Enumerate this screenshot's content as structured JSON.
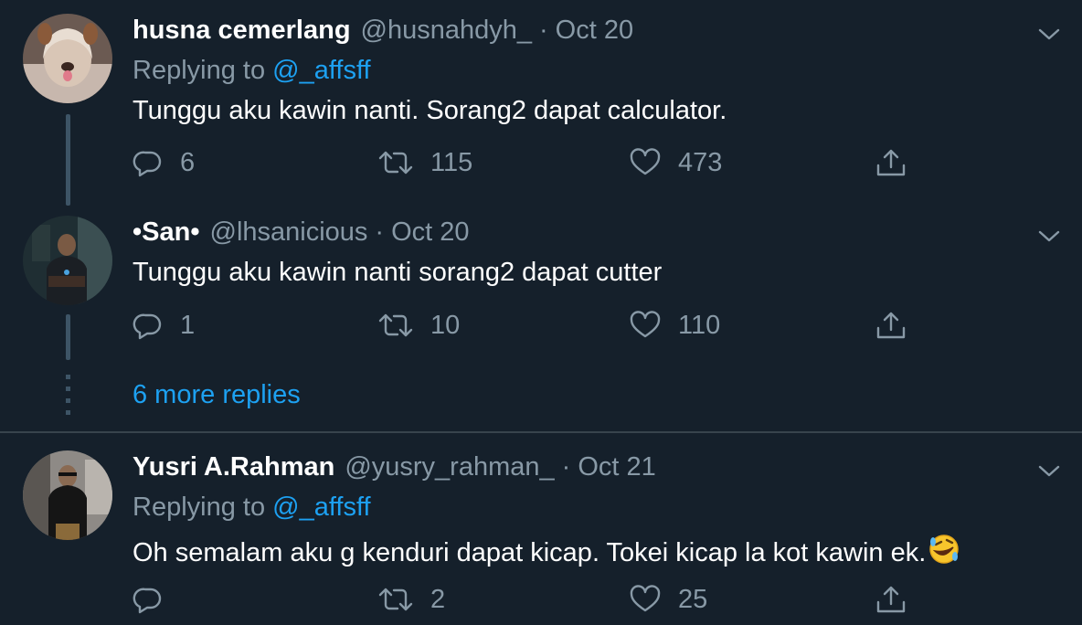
{
  "tweets": [
    {
      "name": "husna cemerlang",
      "handle": "@husnahdyh_",
      "separator": "·",
      "date": "Oct 20",
      "replying_prefix": "Replying to",
      "replying_to": "@_affsff",
      "text": "Tunggu aku kawin nanti. Sorang2 dapat calculator.",
      "replies": "6",
      "retweets": "115",
      "likes": "473"
    },
    {
      "name": "•San•",
      "handle": "@lhsanicious",
      "separator": "·",
      "date": "Oct 20",
      "text": "Tunggu aku kawin nanti sorang2 dapat cutter",
      "replies": "1",
      "retweets": "10",
      "likes": "110"
    },
    {
      "name": "Yusri A.Rahman",
      "handle": "@yusry_rahman_",
      "separator": "·",
      "date": "Oct 21",
      "replying_prefix": "Replying to",
      "replying_to": "@_affsff",
      "text": "Oh semalam aku g kenduri dapat kicap. Tokei kicap la kot kawin ek.",
      "emoji": "rolling-on-floor-laughing-emoji",
      "replies": "",
      "retweets": "2",
      "likes": "25"
    }
  ],
  "more_replies": "6 more replies",
  "colors": {
    "background": "#15202b",
    "text": "#ffffff",
    "muted": "#8899a6",
    "accent": "#1da1f2",
    "divider": "#38444d",
    "thread_line": "#3d5466"
  },
  "icons": {
    "reply": "reply-icon",
    "retweet": "retweet-icon",
    "like": "heart-icon",
    "share": "share-icon",
    "menu": "chevron-down-icon"
  }
}
